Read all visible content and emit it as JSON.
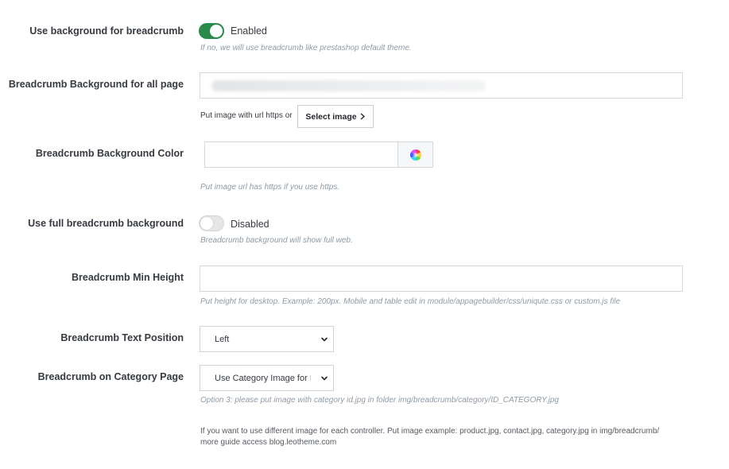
{
  "rows": {
    "use_bg": {
      "label": "Use background for breadcrumb",
      "state": "Enabled",
      "help": "If no, we will use breadcrumb like prestashop default theme."
    },
    "bg_all_page": {
      "label": "Breadcrumb Background for all page",
      "note": "Put image with url https or",
      "button": "Select image",
      "button_icon": "chevron-right-icon"
    },
    "bg_color": {
      "label": "Breadcrumb Background Color",
      "value": "",
      "picker_icon": "color-wheel-icon",
      "help": "Put image url has https if you use https."
    },
    "full_bg": {
      "label": "Use full breadcrumb background",
      "state": "Disabled",
      "help": "Breadcrumb background will show full web."
    },
    "min_height": {
      "label": "Breadcrumb Min Height",
      "value": "",
      "help": "Put height for desktop. Example: 200px. Mobile and table edit in module/appagebuilder/css/uniqute.css or custom.js file"
    },
    "text_position": {
      "label": "Breadcrumb Text Position",
      "selected": "Left"
    },
    "category_page": {
      "label": "Breadcrumb on Category Page",
      "selected": "Use Category Image for Br",
      "help": "Option 3: please put image with category id.jpg in folder img/breadcrumb/category/ID_CATEGORY.jpg"
    }
  },
  "footer_note": {
    "line1": "If you want to use different image for each controller. Put image example: product.jpg, contact.jpg, category.jpg in img/breadcrumb/",
    "line2": "more guide access blog.leotheme.com"
  },
  "colors": {
    "toggle_on": "#2a8a4a",
    "toggle_off": "#e4e6e8",
    "help_text": "#8f9aa5"
  }
}
